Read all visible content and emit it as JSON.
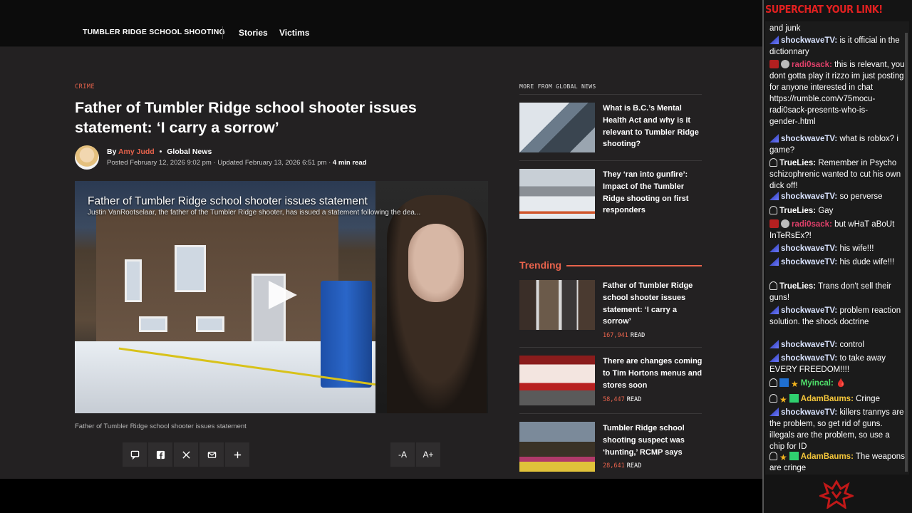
{
  "nav": {
    "brand": "TUMBLER RIDGE SCHOOL SHOOTING",
    "items": [
      "Stories",
      "Victims"
    ]
  },
  "article": {
    "category": "CRIME",
    "headline": "Father of Tumbler Ridge school shooter issues statement: ‘I carry a sorrow’",
    "by": "By",
    "author": "Amy Judd",
    "outlet": "Global News",
    "posted": "Posted February 12, 2026 9:02 pm",
    "updated": "Updated February 13, 2026 6:51 pm",
    "read_time": "4 min read",
    "video_title": "Father of Tumbler Ridge school shooter issues statement",
    "video_sub": "Justin VanRootselaar, the father of the Tumbler Ridge shooter, has issued a statement following the dea...",
    "caption": "Father of Tumbler Ridge school shooter issues statement",
    "share_icons": [
      "comment-icon",
      "facebook-icon",
      "x-icon",
      "email-icon",
      "plus-icon"
    ],
    "font_small": "-A",
    "font_large": "A+"
  },
  "sidebar": {
    "more_heading": "MORE FROM GLOBAL NEWS",
    "more": [
      {
        "title": "What is B.C.’s Mental Health Act and why is it relevant to Tumbler Ridge shooting?"
      },
      {
        "title": "They ‘ran into gunfire’: Impact of the Tumbler Ridge shooting on first responders"
      }
    ],
    "trending_heading": "Trending",
    "trending": [
      {
        "title": "Father of Tumbler Ridge school shooter issues statement: ‘I carry a sorrow’",
        "reads": "167,941",
        "reads_label": "READ"
      },
      {
        "title": "There are changes coming to Tim Hortons menus and stores soon",
        "reads": "58,447",
        "reads_label": "READ"
      },
      {
        "title": "Tumbler Ridge school shooting suspect was ‘hunting,’ RCMP says",
        "reads": "28,641",
        "reads_label": "READ"
      }
    ]
  },
  "chat": {
    "banner": "SUPERCHAT YOUR LINK!",
    "messages": [
      {
        "user": "",
        "text": "and junk"
      },
      {
        "user": "shockwaveTV:",
        "text": " is it official in the dictionnary"
      },
      {
        "user": "radi0sack:",
        "text": " this is relevant, you dont gotta play it rizzo im just posting for anyone interested in chat https://rumble.com/v75mocu-radi0sack-presents-who-is-gender-.html"
      },
      {
        "user": "shockwaveTV:",
        "text": " what is roblox? i game?"
      },
      {
        "user": "TrueLies:",
        "text": " Remember in Psycho schizophrenic wanted to cut his own dick off!"
      },
      {
        "user": "shockwaveTV:",
        "text": " so perverse"
      },
      {
        "user": "TrueLies:",
        "text": " Gay"
      },
      {
        "user": "radi0sack:",
        "text": " but wHaT aBoUt InTeRsEx?!"
      },
      {
        "user": "shockwaveTV:",
        "text": " his wife!!!"
      },
      {
        "user": "shockwaveTV:",
        "text": " his dude wife!!!"
      },
      {
        "user": "TrueLies:",
        "text": " Trans don't sell their guns!"
      },
      {
        "user": "shockwaveTV:",
        "text": " problem reaction solution. the shock doctrine"
      },
      {
        "user": "shockwaveTV:",
        "text": " control"
      },
      {
        "user": "shockwaveTV:",
        "text": " to take away EVERY FREEDOM!!!!"
      },
      {
        "user": "Myincal:",
        "text": " 🩸"
      },
      {
        "user": "AdamBaums:",
        "text": " Cringe"
      },
      {
        "user": "shockwaveTV:",
        "text": " killers trannys are the problem, so get rid of guns. illegals are the problem, so use a chip for ID"
      },
      {
        "user": "AdamBaums:",
        "text": " The weapons are cringe"
      }
    ]
  },
  "colors": {
    "accent": "#e8634c",
    "chat_banner": "#e02020",
    "page_bg": "#232122"
  }
}
